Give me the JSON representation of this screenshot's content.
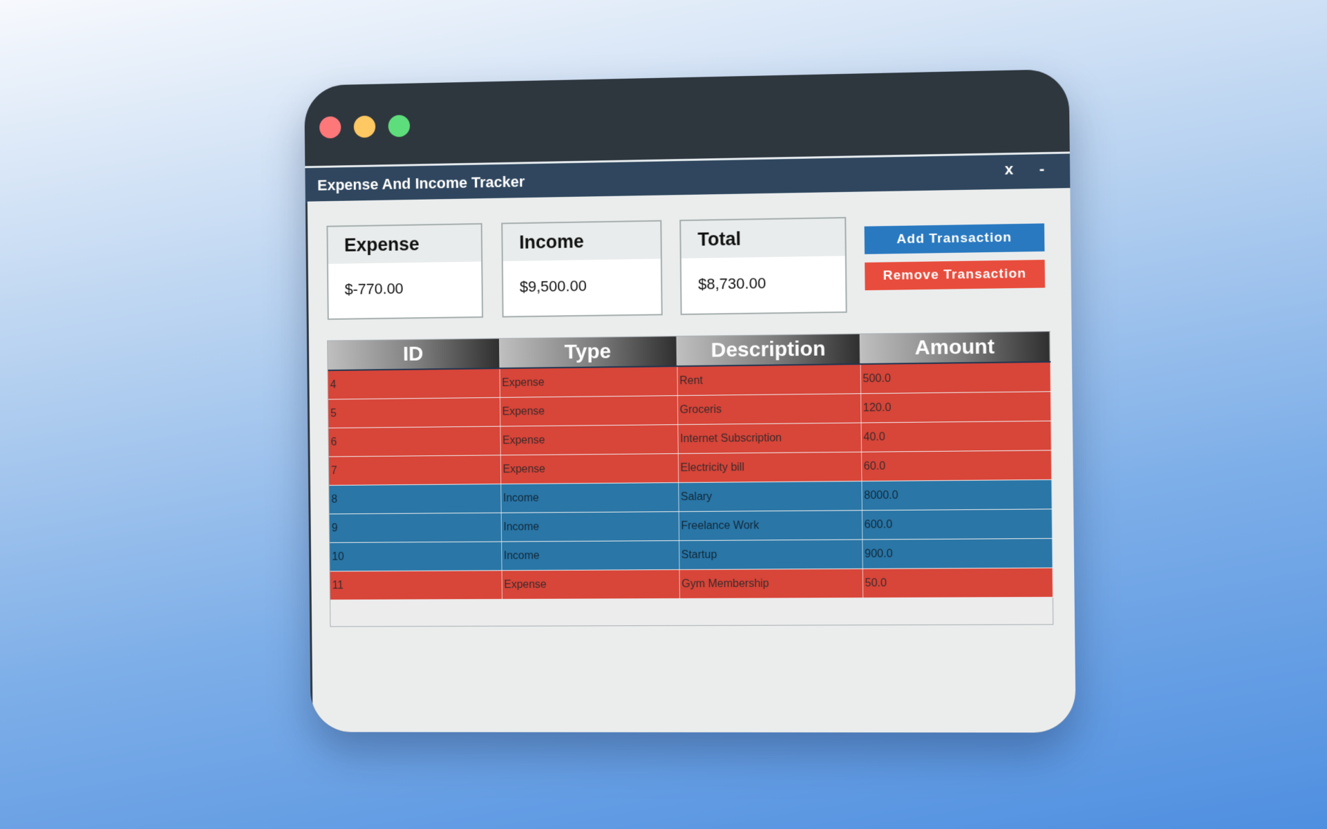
{
  "app": {
    "title": "Expense And Income Tracker",
    "close_label": "x",
    "minimize_label": "-"
  },
  "summary": {
    "expense": {
      "label": "Expense",
      "value": "$-770.00"
    },
    "income": {
      "label": "Income",
      "value": "$9,500.00"
    },
    "total": {
      "label": "Total",
      "value": "$8,730.00"
    }
  },
  "actions": {
    "add_label": "Add Transaction",
    "remove_label": "Remove Transaction"
  },
  "table": {
    "headers": [
      "ID",
      "Type",
      "Description",
      "Amount"
    ],
    "rows": [
      {
        "id": "4",
        "type": "Expense",
        "description": "Rent",
        "amount": "500.0"
      },
      {
        "id": "5",
        "type": "Expense",
        "description": "Groceris",
        "amount": "120.0"
      },
      {
        "id": "6",
        "type": "Expense",
        "description": "Internet Subscription",
        "amount": "40.0"
      },
      {
        "id": "7",
        "type": "Expense",
        "description": "Electricity bill",
        "amount": "60.0"
      },
      {
        "id": "8",
        "type": "Income",
        "description": "Salary",
        "amount": "8000.0"
      },
      {
        "id": "9",
        "type": "Income",
        "description": "Freelance Work",
        "amount": "600.0"
      },
      {
        "id": "10",
        "type": "Income",
        "description": "Startup",
        "amount": "900.0"
      },
      {
        "id": "11",
        "type": "Expense",
        "description": "Gym Membership",
        "amount": "50.0"
      }
    ]
  },
  "colors": {
    "expense_row": "#d84539",
    "income_row": "#2a76a6",
    "add_button": "#2979c0",
    "remove_button": "#e84c3c",
    "titlebar": "#2f465e"
  }
}
